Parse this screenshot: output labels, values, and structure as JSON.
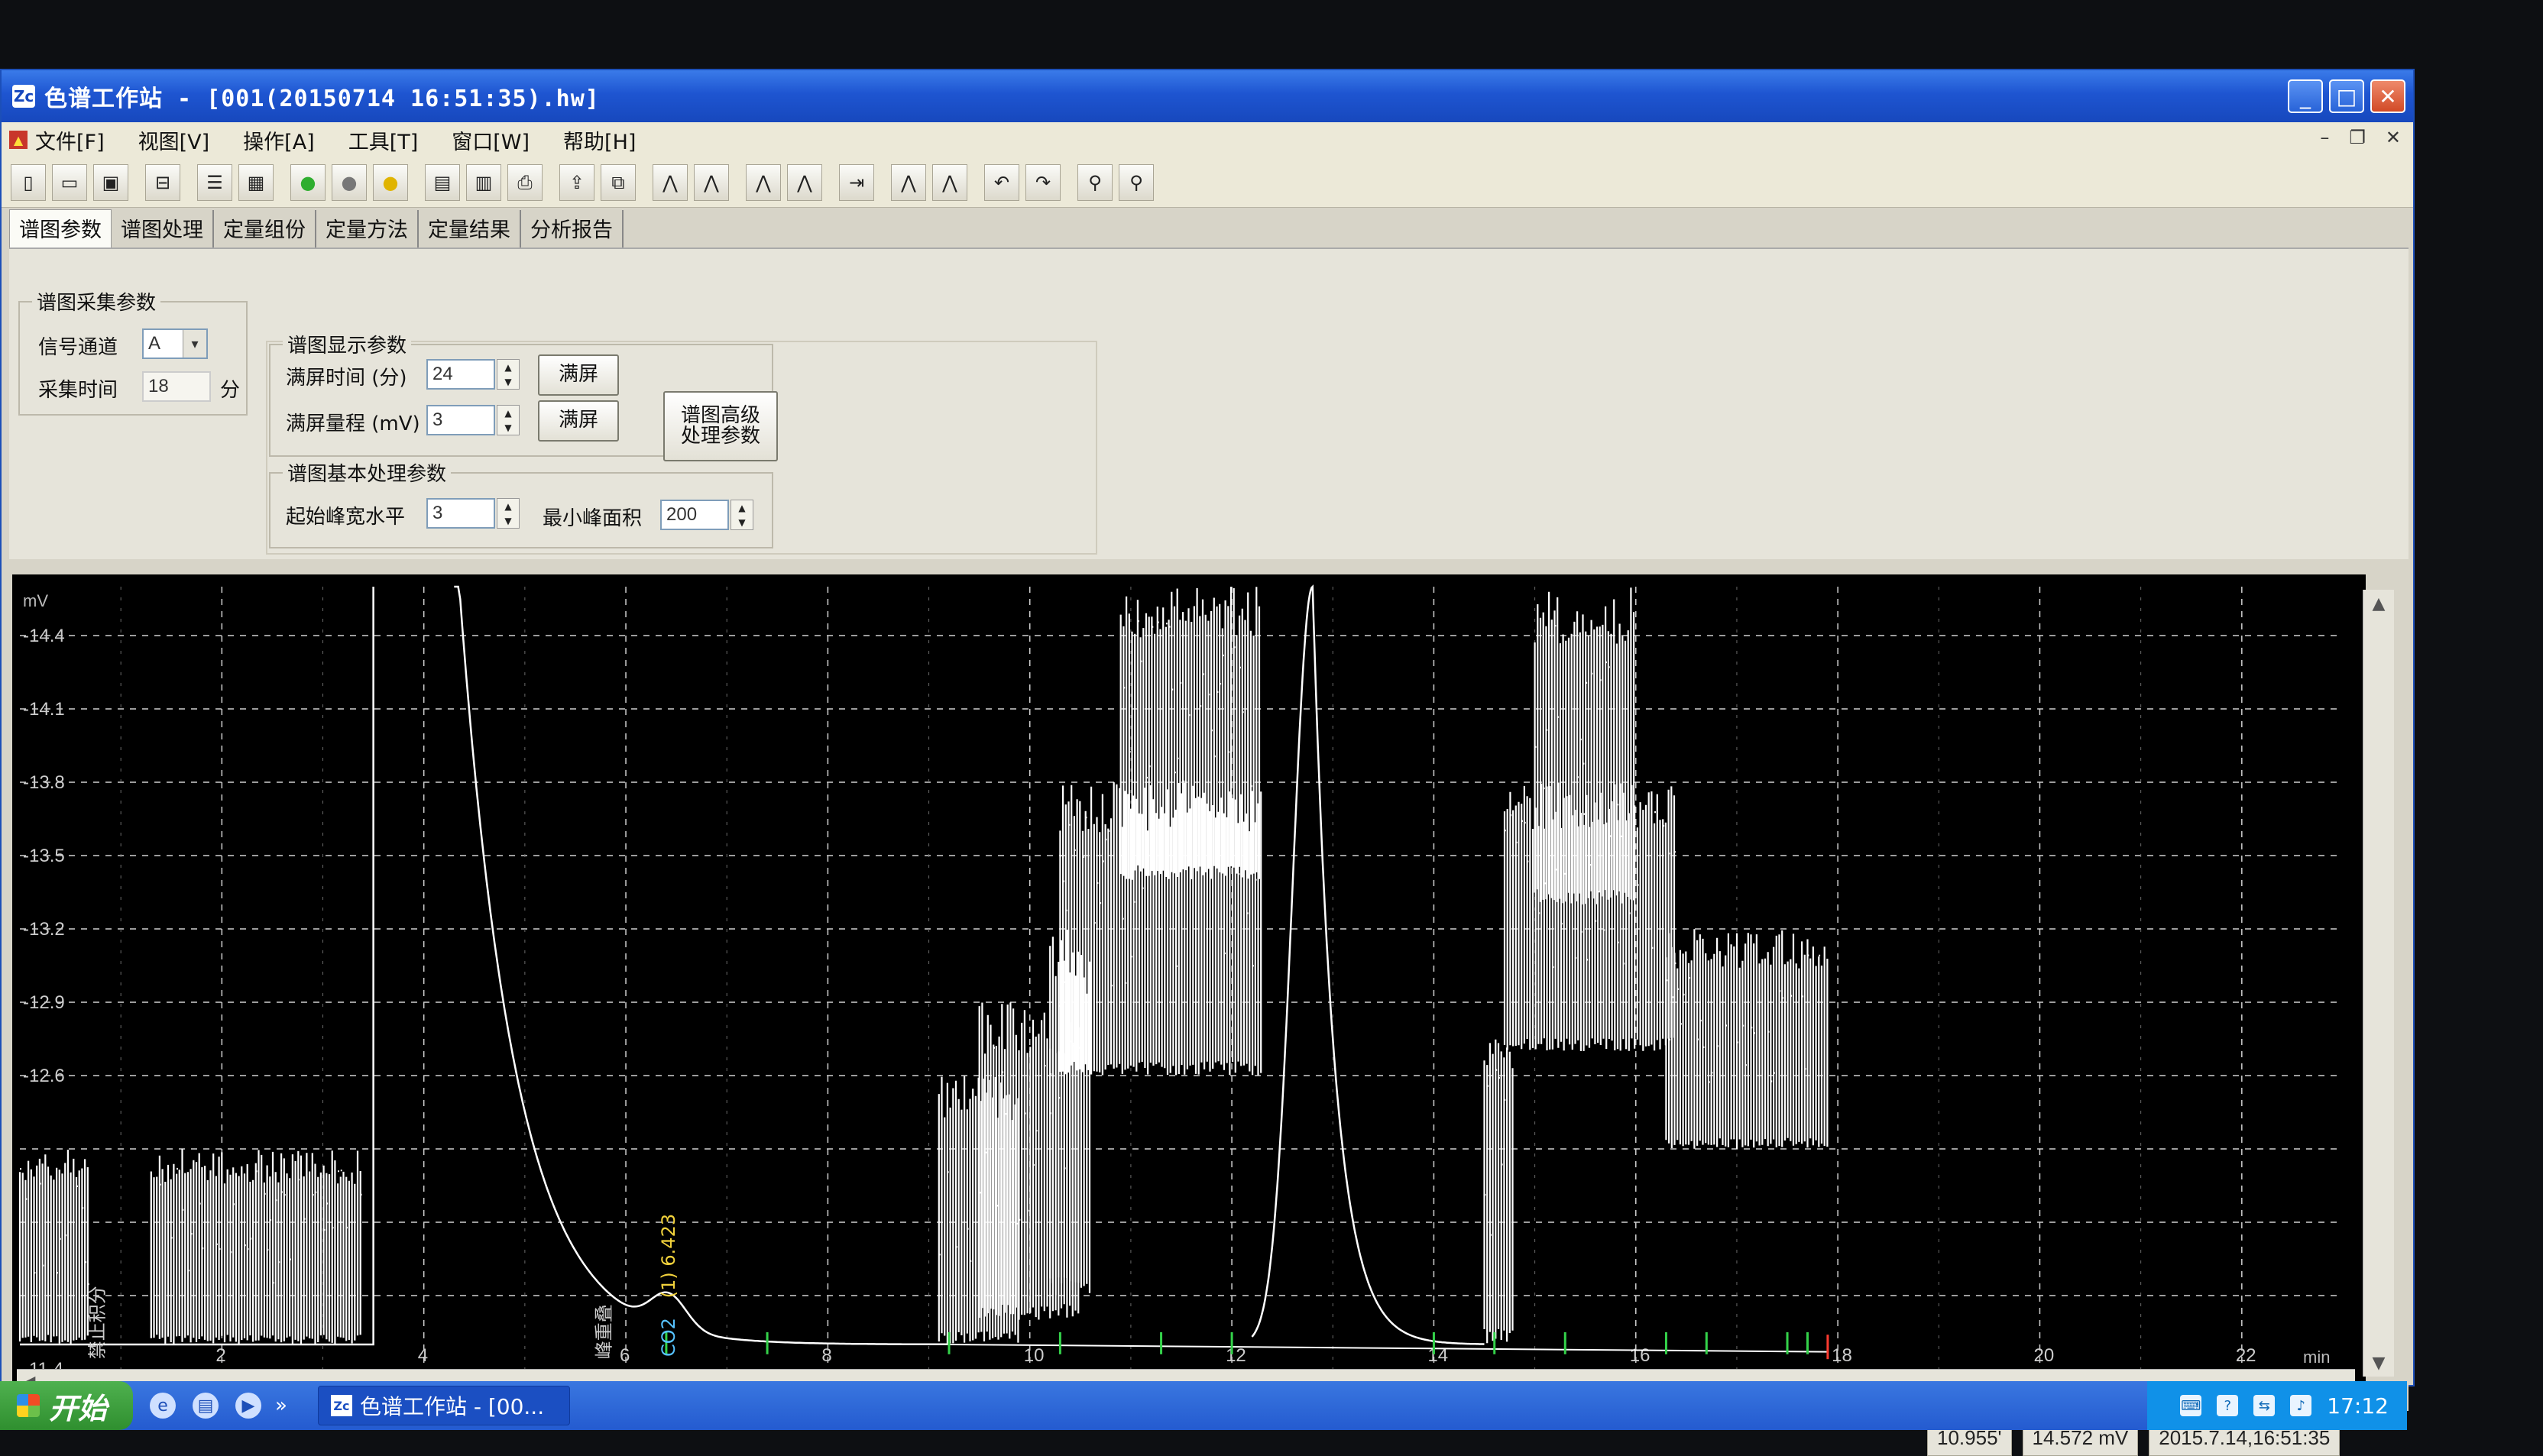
{
  "window": {
    "title": "色谱工作站 - [001(20150714 16:51:35).hw]",
    "app_icon": "Zc",
    "min": "_",
    "max": "□",
    "close": "✕"
  },
  "menu": [
    "文件[F]",
    "视图[V]",
    "操作[A]",
    "工具[T]",
    "窗口[W]",
    "帮助[H]"
  ],
  "mdi_controls": [
    "–",
    "❐",
    "✕"
  ],
  "toolbar_icons": [
    "new-icon",
    "open-icon",
    "save-icon",
    "import-icon",
    "tree-icon",
    "table-icon",
    "start-icon",
    "stop-icon",
    "pause-icon",
    "list-icon",
    "report-icon",
    "print-icon",
    "export-icon",
    "copy-icon",
    "chromatogram-icon",
    "chromatogram-alt-icon",
    "peaks-icon",
    "peaks-alt-icon",
    "baseline-icon",
    "zoom-peak-icon",
    "zoom-peak-alt-icon",
    "undo-icon",
    "redo-icon",
    "person-icon",
    "person-search-icon"
  ],
  "tabs": [
    "谱图参数",
    "谱图处理",
    "定量组份",
    "定量方法",
    "定量结果",
    "分析报告"
  ],
  "acquire": {
    "title": "谱图采集参数",
    "channel_label": "信号通道",
    "channel_value": "A",
    "time_label": "采集时间",
    "time_value": "18",
    "time_unit": "分"
  },
  "display": {
    "title": "谱图显示参数",
    "full_time_label": "满屏时间 (分)",
    "full_time_value": "24",
    "full_range_label": "满屏量程 (mV)",
    "full_range_value": "3",
    "full_btn": "满屏"
  },
  "advanced_btn": "谱图高级\n处理参数",
  "basic": {
    "title": "谱图基本处理参数",
    "width_label": "起始峰宽水平",
    "width_value": "3",
    "area_label": "最小峰面积",
    "area_value": "200"
  },
  "chart_data": {
    "type": "line",
    "ylabel": "mV",
    "xlabel": "min",
    "ylim": [
      11.4,
      14.6
    ],
    "xlim": [
      0,
      23
    ],
    "yticks": [
      11.4,
      12.6,
      12.9,
      13.2,
      13.5,
      13.8,
      14.1,
      14.4
    ],
    "xticks": [
      2,
      4,
      6,
      8,
      10,
      12,
      14,
      16,
      18,
      20,
      22
    ],
    "grid": true,
    "background": "#000000",
    "trace_color": "#ffffff",
    "annotations": [
      {
        "x": 6.423,
        "text": "(1) 6.423",
        "color": "#f2d23c"
      },
      {
        "x": 6.423,
        "text": "CO2",
        "color": "#56c2ff"
      },
      {
        "x": 5.8,
        "text": "峰重叠",
        "color": "#cccccc"
      },
      {
        "x": 0.8,
        "text": "禁止积分",
        "color": "#cccccc"
      }
    ],
    "trace": {
      "baseline": 11.5,
      "rise_x": 3.5,
      "decay_start_x": 4.3,
      "peak": {
        "x": 6.423,
        "height": 0.14
      },
      "peak2": {
        "x": 12.8,
        "top": 14.6
      },
      "noise_segments": [
        {
          "x0": 0.0,
          "x1": 0.7,
          "low": 11.5,
          "high": 12.3
        },
        {
          "x0": 1.3,
          "x1": 3.4,
          "low": 11.5,
          "high": 12.3
        },
        {
          "x0": 9.1,
          "x1": 9.9,
          "low": 11.5,
          "high": 12.6
        },
        {
          "x0": 9.5,
          "x1": 10.5,
          "low": 11.6,
          "high": 12.9
        },
        {
          "x0": 10.2,
          "x1": 10.6,
          "low": 11.7,
          "high": 13.2
        },
        {
          "x0": 10.3,
          "x1": 12.3,
          "low": 12.6,
          "high": 13.8
        },
        {
          "x0": 10.9,
          "x1": 12.3,
          "low": 13.4,
          "high": 14.6
        },
        {
          "x0": 14.5,
          "x1": 14.8,
          "low": 11.5,
          "high": 12.8
        },
        {
          "x0": 14.7,
          "x1": 16.4,
          "low": 12.7,
          "high": 13.8
        },
        {
          "x0": 15.0,
          "x1": 16.0,
          "low": 13.3,
          "high": 14.6
        },
        {
          "x0": 16.3,
          "x1": 17.9,
          "low": 12.3,
          "high": 13.2
        }
      ],
      "markers_green": [
        6.4,
        7.4,
        9.2,
        10.3,
        11.3,
        12.0,
        14.0,
        14.6,
        15.3,
        16.3,
        16.7,
        17.5,
        17.7
      ],
      "marker_red": 17.9
    }
  },
  "status": {
    "time": "10.955'",
    "value": "14.572 mV",
    "datetime": "2015.7.14,16:51:35"
  },
  "taskbar": {
    "start": "开始",
    "task": "色谱工作站 - [00...",
    "expand": "»",
    "clock": "17:12"
  }
}
